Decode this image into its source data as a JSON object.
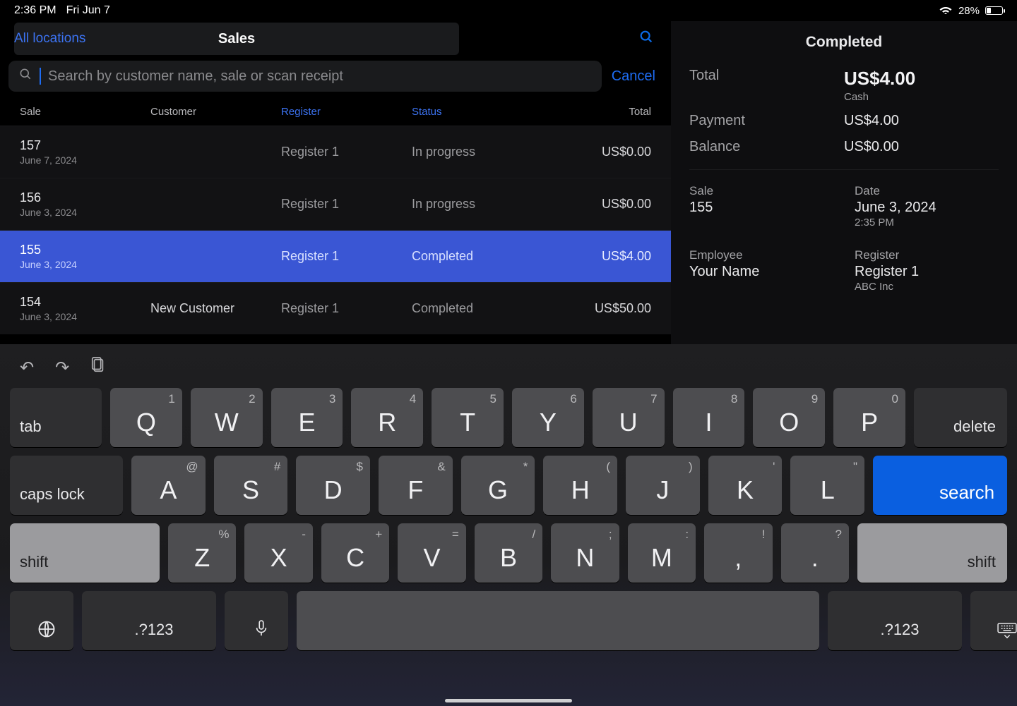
{
  "status_bar": {
    "time": "2:36 PM",
    "date": "Fri Jun 7",
    "battery_pct": "28%"
  },
  "header": {
    "all_locations": "All locations",
    "title": "Sales",
    "cancel": "Cancel",
    "search_placeholder": "Search by customer name, sale or scan receipt"
  },
  "table": {
    "headers": {
      "sale": "Sale",
      "customer": "Customer",
      "register": "Register",
      "status": "Status",
      "total": "Total"
    },
    "rows": [
      {
        "id": "157",
        "date": "June 7, 2024",
        "customer": "",
        "register": "Register 1",
        "status": "In progress",
        "total": "US$0.00",
        "selected": false
      },
      {
        "id": "156",
        "date": "June 3, 2024",
        "customer": "",
        "register": "Register 1",
        "status": "In progress",
        "total": "US$0.00",
        "selected": false
      },
      {
        "id": "155",
        "date": "June 3, 2024",
        "customer": "",
        "register": "Register 1",
        "status": "Completed",
        "total": "US$4.00",
        "selected": true
      },
      {
        "id": "154",
        "date": "June 3, 2024",
        "customer": "New Customer",
        "register": "Register 1",
        "status": "Completed",
        "total": "US$50.00",
        "selected": false
      }
    ]
  },
  "detail": {
    "title": "Completed",
    "total_label": "Total",
    "total_value": "US$4.00",
    "total_sub": "Cash",
    "payment_label": "Payment",
    "payment_value": "US$4.00",
    "balance_label": "Balance",
    "balance_value": "US$0.00",
    "sale_label": "Sale",
    "sale_value": "155",
    "date_label": "Date",
    "date_value": "June 3, 2024",
    "date_time": "2:35 PM",
    "emp_label": "Employee",
    "emp_value": "Your Name",
    "reg_label": "Register",
    "reg_value": "Register 1",
    "reg_sub": "ABC Inc"
  },
  "keyboard": {
    "row1": [
      {
        "main": "Q",
        "hint": "1"
      },
      {
        "main": "W",
        "hint": "2"
      },
      {
        "main": "E",
        "hint": "3"
      },
      {
        "main": "R",
        "hint": "4"
      },
      {
        "main": "T",
        "hint": "5"
      },
      {
        "main": "Y",
        "hint": "6"
      },
      {
        "main": "U",
        "hint": "7"
      },
      {
        "main": "I",
        "hint": "8"
      },
      {
        "main": "O",
        "hint": "9"
      },
      {
        "main": "P",
        "hint": "0"
      }
    ],
    "row2": [
      {
        "main": "A",
        "hint": "@"
      },
      {
        "main": "S",
        "hint": "#"
      },
      {
        "main": "D",
        "hint": "$"
      },
      {
        "main": "F",
        "hint": "&"
      },
      {
        "main": "G",
        "hint": "*"
      },
      {
        "main": "H",
        "hint": "("
      },
      {
        "main": "J",
        "hint": ")"
      },
      {
        "main": "K",
        "hint": "'"
      },
      {
        "main": "L",
        "hint": "\""
      }
    ],
    "row3": [
      {
        "main": "Z",
        "hint": "%"
      },
      {
        "main": "X",
        "hint": "-"
      },
      {
        "main": "C",
        "hint": "+"
      },
      {
        "main": "V",
        "hint": "="
      },
      {
        "main": "B",
        "hint": "/"
      },
      {
        "main": "N",
        "hint": ";"
      },
      {
        "main": "M",
        "hint": ":"
      },
      {
        "main": ",",
        "hint": "!"
      },
      {
        "main": ".",
        "hint": "?"
      }
    ],
    "labels": {
      "tab": "tab",
      "delete": "delete",
      "caps": "caps lock",
      "search": "search",
      "shift_l": "shift",
      "shift_r": "shift",
      "sym": ".?123",
      "symR": ".?123"
    }
  }
}
